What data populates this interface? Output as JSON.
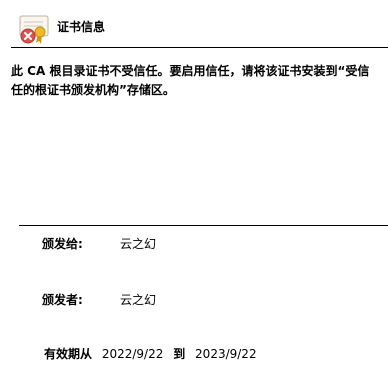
{
  "header": {
    "title": "证书信息",
    "icon": "certificate-error-icon",
    "colors": {
      "error_badge": "#d9534f",
      "ribbon": "#e8a317"
    }
  },
  "warning": {
    "text": "此 CA 根目录证书不受信任。要启用信任，请将该证书安装到“受信任的根证书颁发机构”存储区。"
  },
  "issued_to": {
    "label": "颁发给:",
    "value": "云之幻"
  },
  "issued_by": {
    "label": "颁发者:",
    "value": "云之幻"
  },
  "validity": {
    "label": "有效期从",
    "from": "2022/9/22",
    "to_word": "到",
    "to": "2023/9/22"
  }
}
